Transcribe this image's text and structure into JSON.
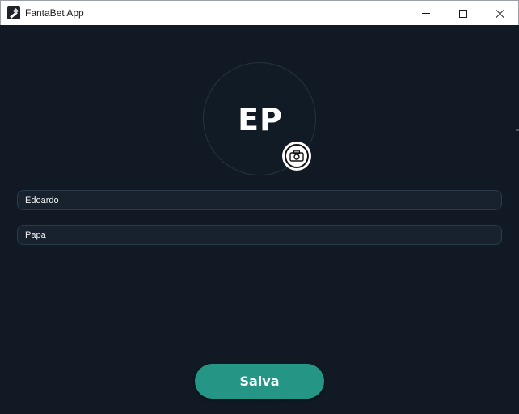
{
  "window": {
    "title": "FantaBet App",
    "icon": "gavel-icon"
  },
  "profile": {
    "initials": "EP",
    "change_photo_icon": "camera-icon"
  },
  "form": {
    "first_name": {
      "value": "Edoardo",
      "placeholder": ""
    },
    "last_name": {
      "value": "Papa",
      "placeholder": ""
    }
  },
  "actions": {
    "save_label": "Salva"
  },
  "colors": {
    "background": "#111a24",
    "field_background": "#17222e",
    "accent": "#259585",
    "text": "#ffffff"
  }
}
